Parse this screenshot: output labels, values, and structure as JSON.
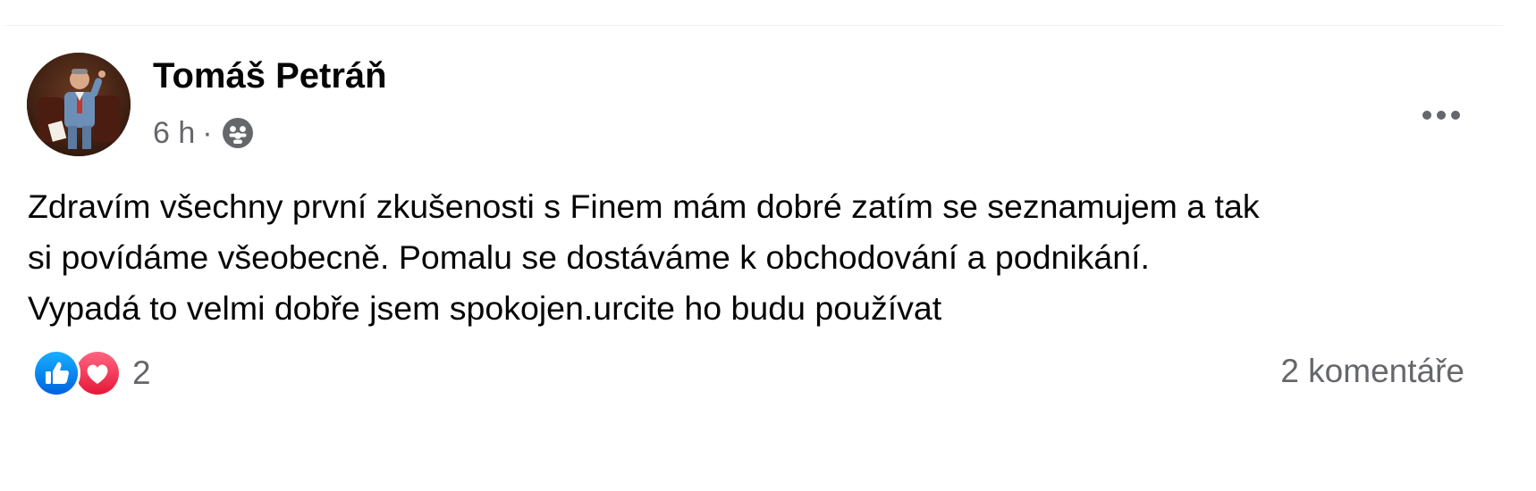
{
  "post": {
    "author": "Tomáš Petráň",
    "time": "6 h",
    "separator": "·",
    "audience_icon": "friends-icon",
    "menu_icon": "more-horizontal-icon",
    "text_lines": [
      "Zdravím všechny první zkušenosti s Finem mám dobré zatím se seznamujem a tak",
      "si povídáme všeobecně. Pomalu se dostáváme k obchodování a podnikání.",
      "Vypadá to velmi dobře jsem spokojen.urcite ho budu používat"
    ],
    "reactions": {
      "icons": [
        "like-reaction-icon",
        "love-reaction-icon"
      ],
      "count": "2"
    },
    "comments": "2 komentáře"
  },
  "colors": {
    "text": "#050505",
    "secondary": "#65676b",
    "like": "#1877f2",
    "love": "#f33e58"
  }
}
